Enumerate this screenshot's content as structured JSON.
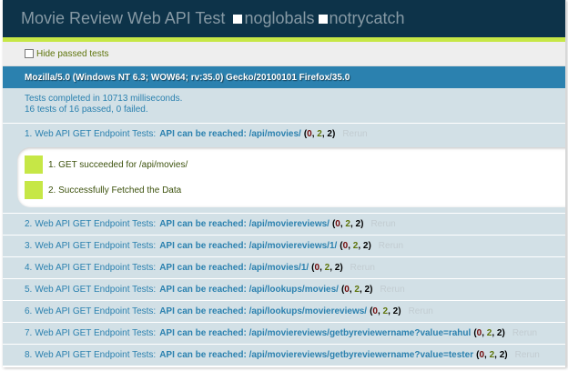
{
  "header": {
    "title": "Movie Review Web API Test",
    "options": [
      "noglobals",
      "notrycatch"
    ]
  },
  "toolbar": {
    "hide_passed_label": "Hide passed tests"
  },
  "user_agent": "Mozilla/5.0 (Windows NT 6.3; WOW64; rv:35.0) Gecko/20100101 Firefox/35.0",
  "result": {
    "line1": "Tests completed in 10713 milliseconds.",
    "line2": "16 tests of 16 passed, 0 failed."
  },
  "tests": [
    {
      "num": "1.",
      "module": "Web API GET Endpoint Tests:",
      "name": "API can be reached: /api/movies/",
      "failed": "0",
      "passed": "2",
      "total": "2",
      "rerun": "Rerun",
      "asserts": [
        "1. GET succeeded for /api/movies/",
        "2. Successfully Fetched the Data"
      ]
    },
    {
      "num": "2.",
      "module": "Web API GET Endpoint Tests:",
      "name": "API can be reached: /api/moviereviews/",
      "failed": "0",
      "passed": "2",
      "total": "2",
      "rerun": "Rerun"
    },
    {
      "num": "3.",
      "module": "Web API GET Endpoint Tests:",
      "name": "API can be reached: /api/moviereviews/1/",
      "failed": "0",
      "passed": "2",
      "total": "2",
      "rerun": "Rerun"
    },
    {
      "num": "4.",
      "module": "Web API GET Endpoint Tests:",
      "name": "API can be reached: /api/movies/1/",
      "failed": "0",
      "passed": "2",
      "total": "2",
      "rerun": "Rerun"
    },
    {
      "num": "5.",
      "module": "Web API GET Endpoint Tests:",
      "name": "API can be reached: /api/lookups/movies/",
      "failed": "0",
      "passed": "2",
      "total": "2",
      "rerun": "Rerun"
    },
    {
      "num": "6.",
      "module": "Web API GET Endpoint Tests:",
      "name": "API can be reached: /api/lookups/moviereviews/",
      "failed": "0",
      "passed": "2",
      "total": "2",
      "rerun": "Rerun"
    },
    {
      "num": "7.",
      "module": "Web API GET Endpoint Tests:",
      "name": "API can be reached: /api/moviereviews/getbyreviewername?value=rahul",
      "failed": "0",
      "passed": "2",
      "total": "2",
      "rerun": "Rerun"
    },
    {
      "num": "8.",
      "module": "Web API GET Endpoint Tests:",
      "name": "API can be reached: /api/moviereviews/getbyreviewername?value=tester",
      "failed": "0",
      "passed": "2",
      "total": "2",
      "rerun": "Rerun"
    }
  ]
}
